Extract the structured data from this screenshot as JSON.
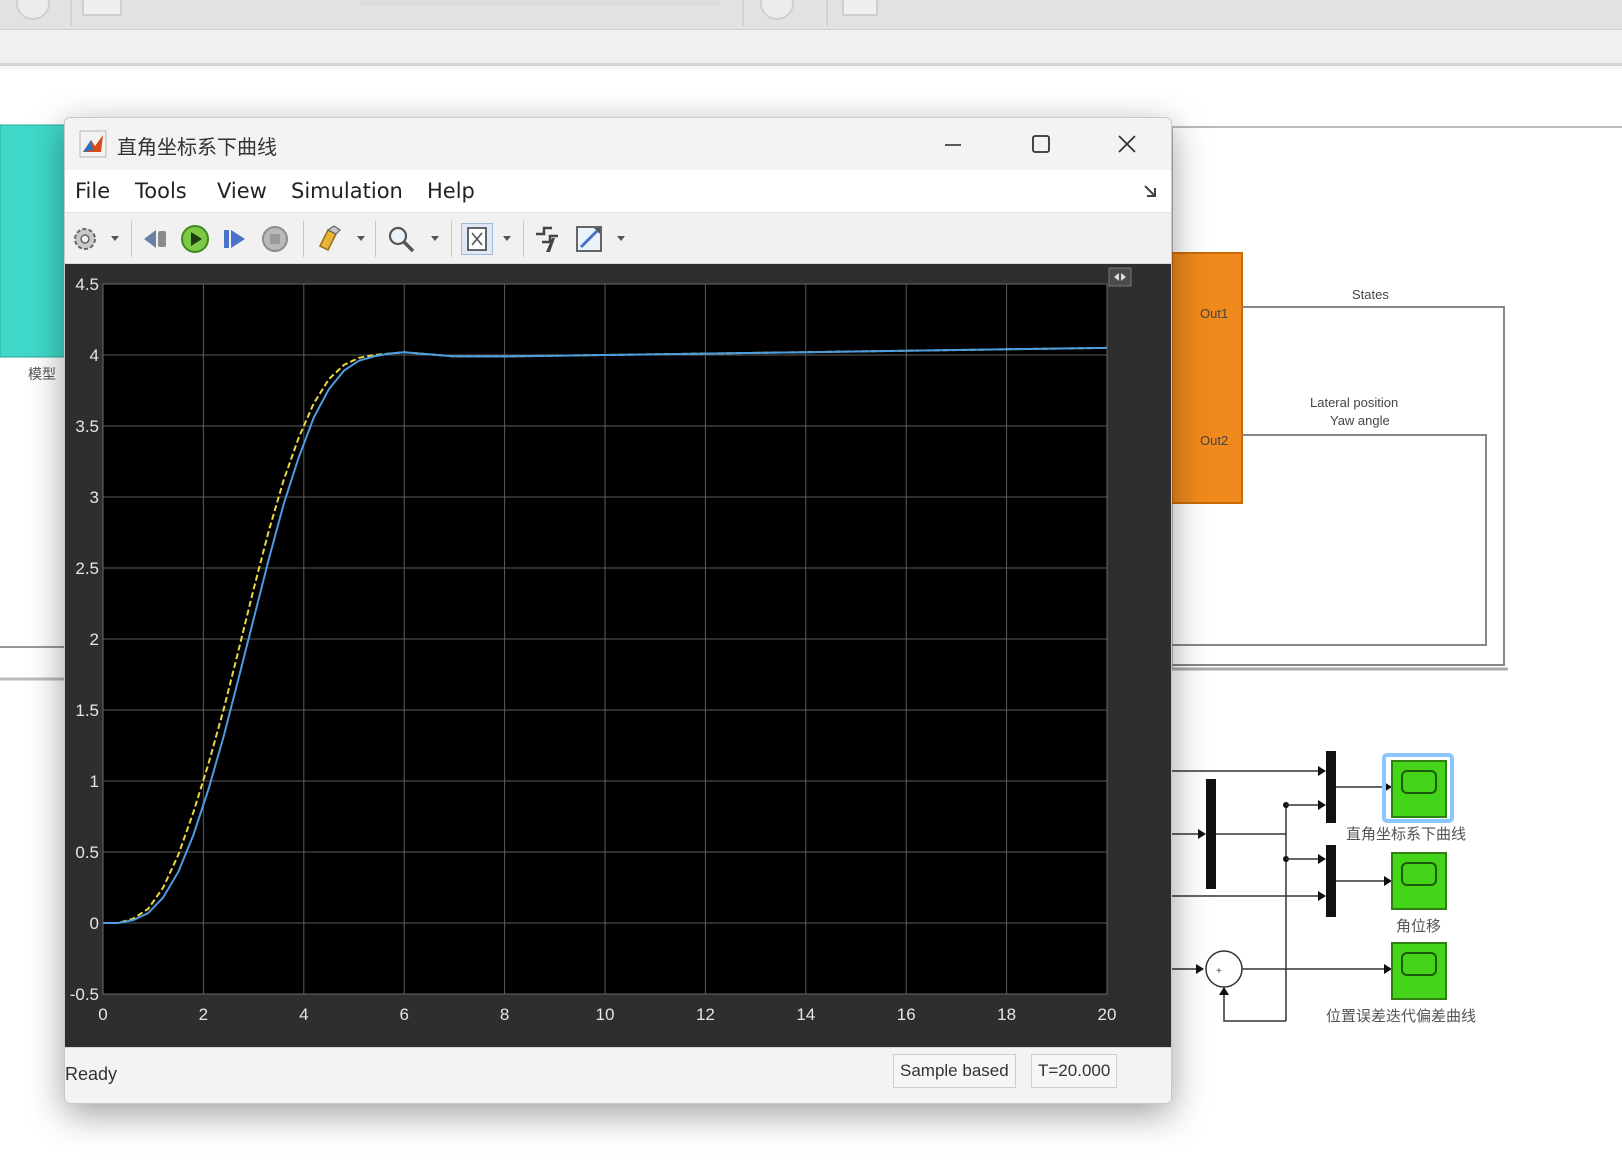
{
  "scope": {
    "title": "直角坐标系下曲线",
    "menu": [
      "File",
      "Tools",
      "View",
      "Simulation",
      "Help"
    ],
    "status": "Ready",
    "mode": "Sample based",
    "time": "T=20.000",
    "colors": {
      "plot_bg": "#000000",
      "frame": "#2e2e2e",
      "grid": "#5c5c5c",
      "series1": "#e6d842",
      "series2": "#4d9be0"
    },
    "toolbar_icons": [
      "gear-icon",
      "step-back-icon",
      "run-icon",
      "step-forward-icon",
      "stop-icon",
      "highlight-icon",
      "zoom-icon",
      "fit-axes-icon",
      "trigger-icon",
      "measure-icon"
    ]
  },
  "chart_data": {
    "type": "line",
    "xlim": [
      0,
      20
    ],
    "ylim": [
      -0.5,
      4.5
    ],
    "xticks": [
      0,
      2,
      4,
      6,
      8,
      10,
      12,
      14,
      16,
      18,
      20
    ],
    "yticks": [
      -0.5,
      0,
      0.5,
      1,
      1.5,
      2,
      2.5,
      3,
      3.5,
      4,
      4.5
    ],
    "xtick_labels": [
      "0",
      "2",
      "4",
      "6",
      "8",
      "10",
      "12",
      "14",
      "16",
      "18",
      "20"
    ],
    "ytick_labels": [
      "-0.5",
      "0",
      "0.5",
      "1",
      "1.5",
      "2",
      "2.5",
      "3",
      "3.5",
      "4",
      "4.5"
    ],
    "grid": true,
    "series": [
      {
        "color": "#e6d842",
        "x": [
          0,
          0.3,
          0.6,
          0.9,
          1.2,
          1.5,
          1.8,
          2.1,
          2.4,
          2.7,
          3.0,
          3.3,
          3.6,
          3.9,
          4.2,
          4.5,
          4.8,
          5.1,
          5.4,
          5.7,
          6.0,
          7,
          8,
          10,
          12,
          14,
          16,
          18,
          20
        ],
        "y": [
          0,
          0,
          0.03,
          0.1,
          0.25,
          0.48,
          0.78,
          1.12,
          1.5,
          1.92,
          2.35,
          2.76,
          3.12,
          3.42,
          3.66,
          3.83,
          3.93,
          3.98,
          4.0,
          4.01,
          4.02,
          3.99,
          3.99,
          4.0,
          4.01,
          4.02,
          4.03,
          4.04,
          4.05
        ]
      },
      {
        "color": "#4d9be0",
        "x": [
          0,
          0.3,
          0.6,
          0.9,
          1.2,
          1.5,
          1.8,
          2.1,
          2.4,
          2.7,
          3.0,
          3.3,
          3.6,
          3.9,
          4.2,
          4.5,
          4.8,
          5.1,
          5.4,
          5.7,
          6.0,
          7,
          8,
          10,
          12,
          14,
          16,
          18,
          20
        ],
        "y": [
          0,
          0,
          0.02,
          0.07,
          0.18,
          0.36,
          0.62,
          0.94,
          1.31,
          1.72,
          2.14,
          2.56,
          2.95,
          3.28,
          3.56,
          3.76,
          3.89,
          3.96,
          3.99,
          4.01,
          4.02,
          3.99,
          3.99,
          4.0,
          4.01,
          4.02,
          4.03,
          4.04,
          4.05
        ]
      }
    ]
  },
  "model": {
    "out1": "Out1",
    "out2": "Out2",
    "label_states": "States",
    "label_lateral": "Lateral position",
    "label_yaw": "Yaw angle",
    "scope1_name": "直角坐标系下曲线",
    "scope2_name": "角位移",
    "scope3_name": "位置误差迭代偏差曲线",
    "left_label": "模型",
    "colors": {
      "subsystem": "#f08a1c",
      "left_block": "#40d9c9",
      "scope_block": "#44d41a"
    }
  }
}
